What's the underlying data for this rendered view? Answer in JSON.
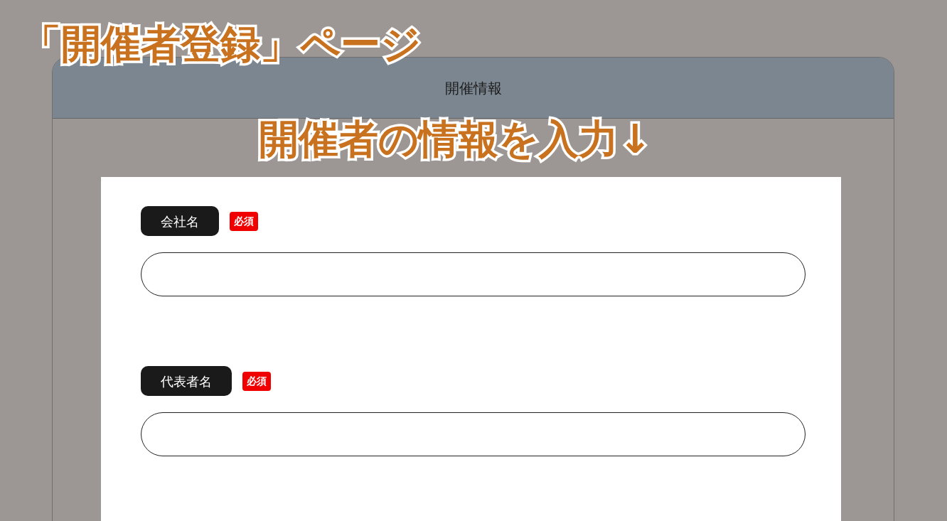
{
  "annotations": [
    {
      "kind": "corner",
      "text": "「開催者登録」ページ"
    },
    {
      "kind": "center",
      "text": "開催者の情報を入力↓"
    }
  ],
  "panel": {
    "title": "開催情報"
  },
  "fields": [
    {
      "label": "会社名",
      "required": true,
      "badge": "必須"
    },
    {
      "label": "代表者名",
      "required": true,
      "badge": "必須"
    }
  ]
}
